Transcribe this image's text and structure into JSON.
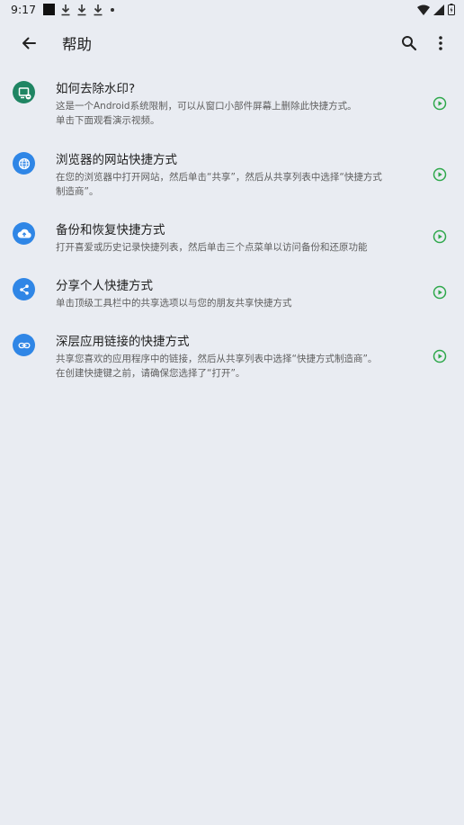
{
  "status_bar": {
    "time": "9:17",
    "icons": [
      "notification-square-icon",
      "download-icon",
      "download-icon",
      "download-icon",
      "dot-icon",
      "wifi-icon",
      "signal-icon",
      "battery-icon"
    ]
  },
  "app_bar": {
    "title": "帮助",
    "back_icon": "arrow-back-icon",
    "search_icon": "search-icon",
    "more_icon": "more-vert-icon"
  },
  "colors": {
    "background": "#e9ecf2",
    "accent_blue": "#2f86e6",
    "accent_green": "#1f8563",
    "play_green": "#2ea84b"
  },
  "help_items": [
    {
      "icon": "watermark-icon",
      "title": "如何去除水印?",
      "desc_lines": [
        "这是一个Android系统限制，可以从窗口小部件屏幕上删除此快捷方式。",
        "单击下面观看演示视频。"
      ]
    },
    {
      "icon": "globe-icon",
      "title": "浏览器的网站快捷方式",
      "desc_lines": [
        "在您的浏览器中打开网站，然后单击“共享”，然后从共享列表中选择“快捷方式",
        "制造商”。"
      ]
    },
    {
      "icon": "cloud-upload-icon",
      "title": "备份和恢复快捷方式",
      "desc_lines": [
        "打开喜爱或历史记录快捷列表，然后单击三个点菜单以访问备份和还原功能"
      ]
    },
    {
      "icon": "share-icon",
      "title": "分享个人快捷方式",
      "desc_lines": [
        "单击顶级工具栏中的共享选项以与您的朋友共享快捷方式"
      ]
    },
    {
      "icon": "link-icon",
      "title": "深层应用链接的快捷方式",
      "desc_lines": [
        "共享您喜欢的应用程序中的链接，然后从共享列表中选择“快捷方式制造商”。",
        "在创建快捷键之前，请确保您选择了“打开”。"
      ]
    }
  ]
}
